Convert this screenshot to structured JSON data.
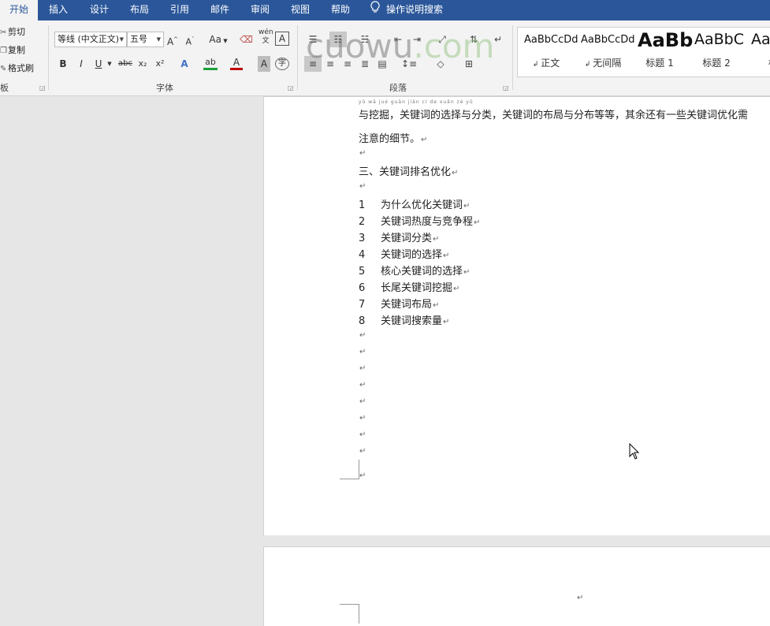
{
  "tabs": [
    "开始",
    "插入",
    "设计",
    "布局",
    "引用",
    "邮件",
    "审阅",
    "视图",
    "帮助"
  ],
  "tell_me": "操作说明搜索",
  "clipboard": {
    "cut": "剪切",
    "copy": "复制",
    "format_painter": "格式刷",
    "group_label": "板"
  },
  "font": {
    "font_name": "等线 (中文正文)",
    "font_size": "五号",
    "change_case": "Aa",
    "phonetic": "wén",
    "bold": "B",
    "italic": "I",
    "underline": "U",
    "strikethrough": "abc",
    "subscript": "x₂",
    "superscript": "x²",
    "group_label": "字体"
  },
  "paragraph": {
    "group_label": "段落"
  },
  "styles": [
    {
      "sample": "AaBbCcDd",
      "name": "正文"
    },
    {
      "sample": "AaBbCcDd",
      "name": "无间隔"
    },
    {
      "sample": "AaBb",
      "name": "标题 1"
    },
    {
      "sample": "AaBbC",
      "name": "标题 2"
    },
    {
      "sample": "Aa",
      "name": "标"
    }
  ],
  "watermark": {
    "main": "cuowu",
    "suffix": ".com"
  },
  "document": {
    "top_phonetic": "yǔ wā jué    guān jiàn cí de xuǎn zé yǔ",
    "line1": "与挖掘，关键词的选择与分类，关键词的布局与分布等等，其余还有一些关键词优化需",
    "line2": "注意的细节。",
    "heading": "三、关键词排名优化",
    "list": [
      {
        "num": "1",
        "text": "为什么优化关键词"
      },
      {
        "num": "2",
        "text": "关键词热度与竞争程"
      },
      {
        "num": "3",
        "text": "关键词分类"
      },
      {
        "num": "4",
        "text": "关键词的选择"
      },
      {
        "num": "5",
        "text": "核心关键词的选择"
      },
      {
        "num": "6",
        "text": "长尾关键词挖掘"
      },
      {
        "num": "7",
        "text": "关键词布局"
      },
      {
        "num": "8",
        "text": "关键词搜索量"
      }
    ],
    "paragraph_mark": "↵"
  }
}
